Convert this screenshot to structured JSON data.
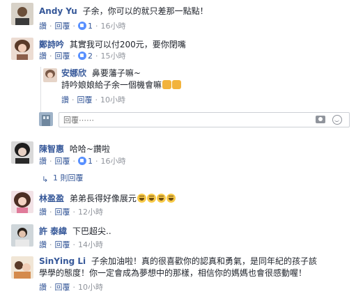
{
  "comments": [
    {
      "name": "Andy Yu",
      "text": "子余，你可以的就只差那一點點！",
      "like": "讚",
      "reply": "回覆",
      "likes": "1",
      "time": "16小時"
    },
    {
      "name": "鄭詩吟",
      "text": "其實我可以付200元，要你閉嘴",
      "like": "讚",
      "reply": "回覆",
      "likes": "2",
      "time": "15小時"
    },
    {
      "name": "安娜欣",
      "text_line1": "鼻要藩子嘛~",
      "text_line2": "詩吟娘娘給子余一個機會嘛",
      "like": "讚",
      "reply": "回覆",
      "time": "10小時"
    },
    {
      "name": "陳智惠",
      "text": "哈哈~讚啦",
      "like": "讚",
      "reply": "回覆",
      "likes": "1",
      "time": "16小時",
      "replies_link": "1 則回覆"
    },
    {
      "name": "林盈盈",
      "text": "弟弟長得好像展元",
      "like": "讚",
      "reply": "回覆",
      "time": "12小時"
    },
    {
      "name": "許 泰緯",
      "text": "下巴超尖..",
      "like": "讚",
      "reply": "回覆",
      "time": "14小時"
    },
    {
      "name": "SinYing Li",
      "text_line1": "子余加油啦！真的很喜歡你的認真和勇氣，是同年紀的孩子該",
      "text_line2": "學學的態度！你一定會成為夢想中的那樣，相信你的媽媽也會很感動喔！",
      "like": "讚",
      "reply": "回覆",
      "time": "10小時"
    }
  ],
  "reply_box": {
    "placeholder": "回覆⋯⋯"
  },
  "icons": {
    "like": "thumbs-up-icon",
    "camera": "camera-icon",
    "emoji": "smiley-icon",
    "reply_arrow": "reply-arrow-icon"
  },
  "colors": {
    "name_link": "#365899",
    "meta": "#90949c",
    "like_badge": "#5890ff",
    "border": "#dddfe2"
  }
}
